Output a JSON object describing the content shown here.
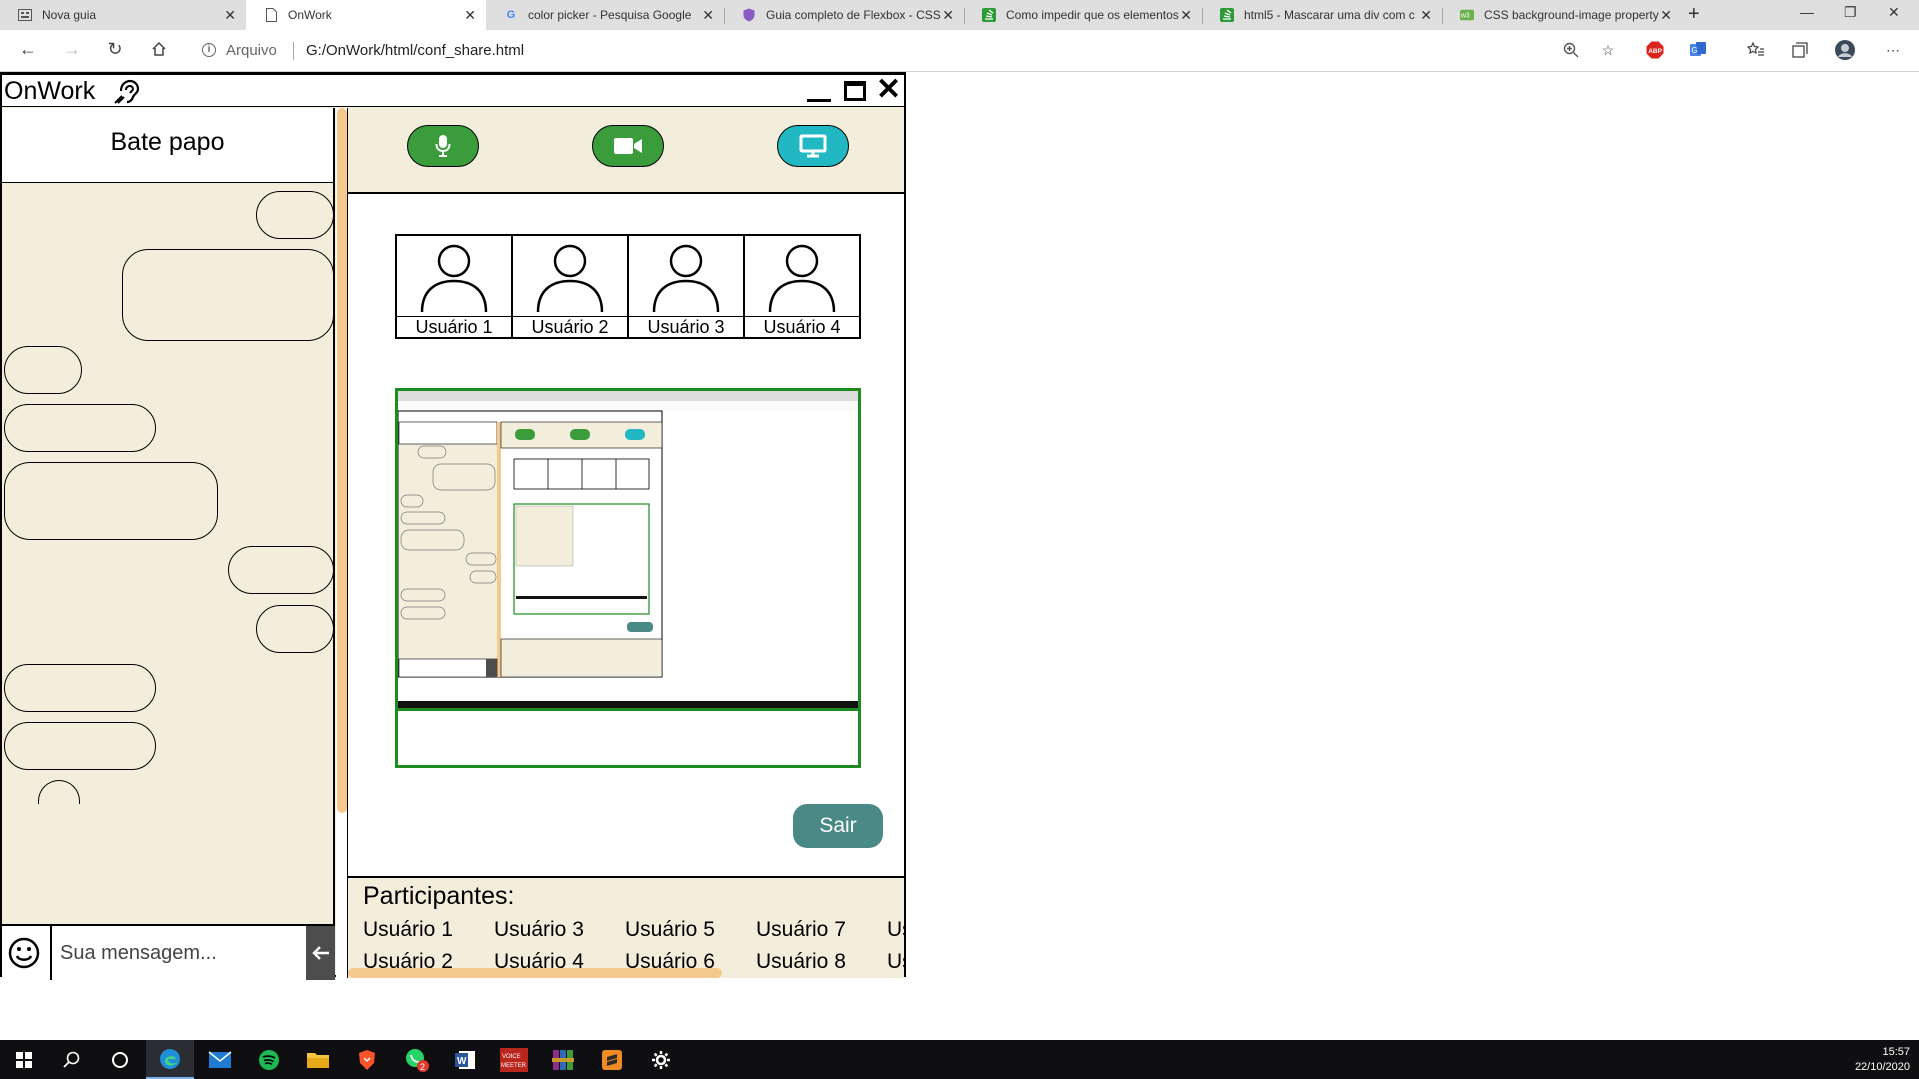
{
  "browser": {
    "tabs": [
      {
        "label": "Nova guia",
        "icon": "newtab-icon"
      },
      {
        "label": "OnWork",
        "icon": "page-icon"
      },
      {
        "label": "color picker - Pesquisa Google",
        "icon": "google-icon"
      },
      {
        "label": "Guia completo de Flexbox - CSS",
        "icon": "shield-icon"
      },
      {
        "label": "Como impedir que os elementos",
        "icon": "stackoverflow-icon"
      },
      {
        "label": "html5 - Mascarar uma div com c",
        "icon": "stackoverflow-icon"
      },
      {
        "label": "CSS background-image property",
        "icon": "w3schools-icon"
      }
    ],
    "address": {
      "scheme_label": "Arquivo",
      "url": "G:/OnWork/html/conf_share.html"
    }
  },
  "app": {
    "title": "OnWork",
    "chat": {
      "title": "Bate papo",
      "input_placeholder": "Sua mensagem..."
    },
    "conference": {
      "users": [
        "Usuário 1",
        "Usuário 2",
        "Usuário 3",
        "Usuário 4"
      ],
      "exit_label": "Sair",
      "participants_title": "Participantes:",
      "participants": [
        "Usuário 1",
        "Usuário 2",
        "Usuário 3",
        "Usuário 4",
        "Usuário 5",
        "Usuário 6",
        "Usuário 7",
        "Usuário 8",
        "Us",
        "Us"
      ]
    },
    "colors": {
      "panel_bg": "#f3eedc",
      "mic_button": "#3a9c3a",
      "camera_button": "#3a9c3a",
      "screen_button": "#21b8c4",
      "exit_button": "#4a8a86",
      "scroll_thumb": "#f5c98d",
      "share_border": "#1f8a1f"
    }
  },
  "taskbar": {
    "time": "15:57",
    "date": "22/10/2020",
    "whatsapp_badge": "2",
    "voicemeeter_label": "VOICE MEETER"
  }
}
